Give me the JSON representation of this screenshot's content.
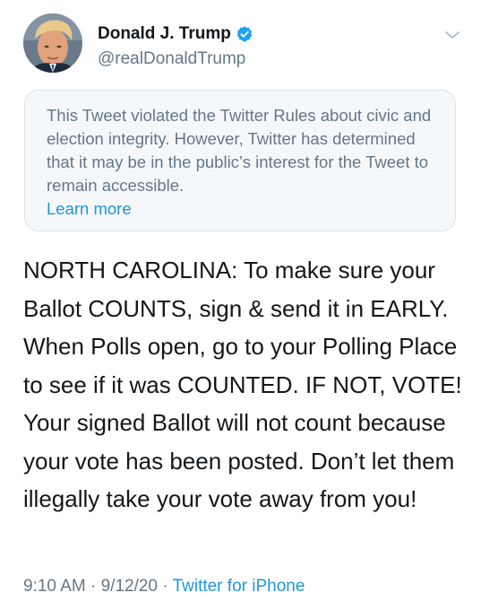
{
  "user": {
    "display_name": "Donald J. Trump",
    "handle": "@realDonaldTrump",
    "verified": true,
    "avatar_icon": "profile-photo",
    "verified_icon": "verified-badge-icon"
  },
  "notice": {
    "text": "This Tweet violated the Twitter Rules about civic and election integrity. However, Twitter has determined that it may be in the public’s interest for the Tweet to remain accessible.",
    "link_label": "Learn more"
  },
  "tweet": {
    "text": "NORTH CAROLINA: To make sure your Ballot COUNTS, sign & send it in EARLY. When Polls open, go to your Polling Place to see if it was COUNTED. IF NOT, VOTE! Your signed Ballot will not count because your vote has been posted. Don’t let them illegally take your vote away from you!"
  },
  "meta": {
    "time": "9:10 AM",
    "separator": "·",
    "date": "9/12/20",
    "source": "Twitter for iPhone"
  },
  "colors": {
    "text": "#14171a",
    "secondary": "#657786",
    "link": "#1b95e0",
    "notice_bg": "#f5f8fa",
    "verified": "#1da1f2"
  }
}
